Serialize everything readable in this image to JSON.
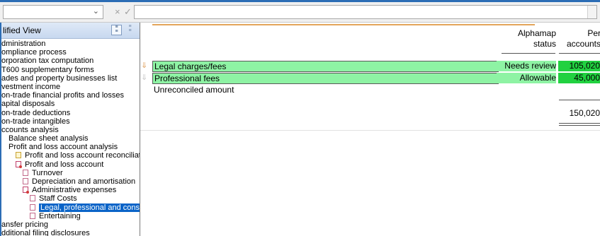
{
  "formula_bar": {
    "cancel_icon": "×",
    "ok_icon": "✓",
    "dropdown_icon": "⌄"
  },
  "tree": {
    "title": "lified View",
    "items": [
      {
        "label": "dministration",
        "indent": 0,
        "icon": "none"
      },
      {
        "label": "ompliance process",
        "indent": 0,
        "icon": "none"
      },
      {
        "label": "orporation tax computation",
        "indent": 0,
        "icon": "none"
      },
      {
        "label": "T600 supplementary forms",
        "indent": 0,
        "icon": "none"
      },
      {
        "label": "ades and property businesses list",
        "indent": 0,
        "icon": "none"
      },
      {
        "label": "vestment income",
        "indent": 0,
        "icon": "none"
      },
      {
        "label": "on-trade financial profits and losses",
        "indent": 0,
        "icon": "none"
      },
      {
        "label": "apital disposals",
        "indent": 0,
        "icon": "none"
      },
      {
        "label": "on-trade deductions",
        "indent": 0,
        "icon": "none"
      },
      {
        "label": "on-trade intangibles",
        "indent": 0,
        "icon": "none"
      },
      {
        "label": "ccounts analysis",
        "indent": 0,
        "icon": "none"
      },
      {
        "label": "Balance sheet analysis",
        "indent": 1,
        "icon": "none"
      },
      {
        "label": "Profit and loss account analysis",
        "indent": 1,
        "icon": "none"
      },
      {
        "label": "Profit and loss account reconciliation",
        "indent": 2,
        "icon": "yellow"
      },
      {
        "label": "Profit and loss account",
        "indent": 2,
        "icon": "red"
      },
      {
        "label": "Turnover",
        "indent": 3,
        "icon": "plain"
      },
      {
        "label": "Depreciation and amortisation",
        "indent": 3,
        "icon": "plain"
      },
      {
        "label": "Administrative expenses",
        "indent": 3,
        "icon": "red"
      },
      {
        "label": "Staff Costs",
        "indent": 4,
        "icon": "plain"
      },
      {
        "label": "Legal, professional and consulta",
        "indent": 4,
        "icon": "plain",
        "selected": true
      },
      {
        "label": "Entertaining",
        "indent": 4,
        "icon": "plain"
      },
      {
        "label": "ansfer pricing",
        "indent": 0,
        "icon": "none"
      },
      {
        "label": "dditional filing disclosures",
        "indent": 0,
        "icon": "none"
      }
    ]
  },
  "main": {
    "columns": {
      "status_line1": "Alphamap",
      "status_line2": "status",
      "per_line1": "Per",
      "per_line2": "accounts"
    },
    "rows": [
      {
        "label": "Legal charges/fees",
        "status": "Needs review",
        "amount": "105,020",
        "highlight": true
      },
      {
        "label": "Professional fees",
        "status": "Allowable",
        "amount": "45,000",
        "highlight": true
      },
      {
        "label": "Unreconciled amount",
        "status": "",
        "amount": "",
        "highlight": false
      }
    ],
    "total": "150,020"
  },
  "colors": {
    "accent_blue": "#2c6db5",
    "row_highlight": "#8ef3a4",
    "amount_highlight": "#21d140",
    "selection": "#0a64c8"
  }
}
